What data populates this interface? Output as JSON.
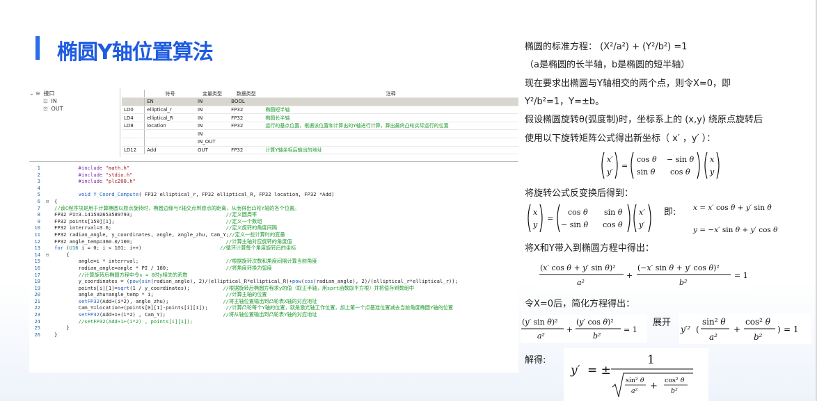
{
  "title": "椭圆Y轴位置算法",
  "tree": {
    "root": "接口",
    "items": [
      "IN",
      "OUT"
    ]
  },
  "var_table": {
    "headers": [
      "符号",
      "变量类型",
      "数据类型",
      "注释"
    ],
    "rows": [
      {
        "label": "",
        "name": "EN",
        "var_type": "IN",
        "data_type": "BOOL",
        "comment": ""
      },
      {
        "label": "LD0",
        "name": "elliptical_r",
        "var_type": "IN",
        "data_type": "FP32",
        "comment": "椭圆短半轴"
      },
      {
        "label": "LD4",
        "name": "elliptical_R",
        "var_type": "IN",
        "data_type": "FP32",
        "comment": "椭圆长半轴"
      },
      {
        "label": "LD8",
        "name": "location",
        "var_type": "IN",
        "data_type": "FP32",
        "comment": "运行的基点位置，根据该位置和计算出的Y轴进行计算，算出最终凸轮实际运行的位置"
      },
      {
        "label": "",
        "name": "",
        "var_type": "IN",
        "data_type": "",
        "comment": ""
      },
      {
        "label": "",
        "name": "",
        "var_type": "IN_OUT",
        "data_type": "",
        "comment": ""
      },
      {
        "label": "LD12",
        "name": "Add",
        "var_type": "OUT",
        "data_type": "FP32",
        "comment": "计算Y轴坐标后输出的地址"
      }
    ]
  },
  "code_lines": [
    {
      "n": "1",
      "fold": "",
      "html": "        <span class='mac'>#include</span> <span class='str'>\"math.h\"</span>"
    },
    {
      "n": "2",
      "fold": "",
      "html": "        <span class='mac'>#include</span> <span class='str'>\"stdio.h\"</span>"
    },
    {
      "n": "3",
      "fold": "",
      "html": "        <span class='mac'>#include</span> <span class='str'>\"plc200.h\"</span>"
    },
    {
      "n": "4",
      "fold": "",
      "html": ""
    },
    {
      "n": "5",
      "fold": "",
      "html": "        <span class='kw'>void</span> <span class='fn'>Y_Coord_Compute</span>( FP32 elliptical_r, FP32 elliptical_R, FP32 location, FP32 *Add)"
    },
    {
      "n": "6",
      "fold": "⊟",
      "html": "{"
    },
    {
      "n": "7",
      "fold": "",
      "html": "<span class='c'>//该C程序块是用于计算椭圆以原点旋转时，椭圆边缘与Y轴交点到原点的距离，从而得出凸轮Y轴的各个位置。</span>"
    },
    {
      "n": "8",
      "fold": "",
      "html": "FP32 PI=3.141592653589793;                               <span class='c'>//定义圆周率</span>"
    },
    {
      "n": "9",
      "fold": "",
      "html": "FP32 points[150][1];                                     <span class='c'>//定义一个数组</span>"
    },
    {
      "n": "10",
      "fold": "",
      "html": "FP32 interrval=3.6;                                      <span class='c'>//定义旋转的角度间隔</span>"
    },
    {
      "n": "11",
      "fold": "",
      "html": "FP32 radian_angle, y_coordinates, angle, angle_zhu, Cam_Y;<span class='c'>//定义一些计算时的变量</span>"
    },
    {
      "n": "12",
      "fold": "",
      "html": "FP32 angle_temp=360.0/100;                               <span class='c'>//计算主轴对应旋转的角度值</span>"
    },
    {
      "n": "13",
      "fold": "",
      "html": "<span class='kw'>for</span> (<span class='ty'>U16</span> i = 0; i &lt; 101; i++)                          <span class='c'>//循环计算每个角度旋转后的坐标</span>"
    },
    {
      "n": "14",
      "fold": "⊟",
      "html": "    {"
    },
    {
      "n": "15",
      "fold": "",
      "html": "        angle=i * interrval;                             <span class='c'>//根据旋转次数和角度间隔计算当前角度</span>"
    },
    {
      "n": "16",
      "fold": "",
      "html": "        radian_angle=angle * PI / 180;                   <span class='c'>//将角度转换为弧度</span>"
    },
    {
      "n": "17",
      "fold": "",
      "html": "        <span class='c'>//计算旋转后椭圆方程中令x = 0时y相关的系数</span>"
    },
    {
      "n": "18",
      "fold": "",
      "html": "        y_coordinates = (<span class='fn'>pow</span>(<span class='fn'>sin</span>(radian_angle), 2)/(elliptical_R*elliptical_R)+<span class='fn'>pow</span>(<span class='fn'>cos</span>(radian_angle), 2)/(elliptical_r*elliptical_r));"
    },
    {
      "n": "19",
      "fold": "",
      "html": "        points[i][1]=<span class='fn'>sqrt</span>(1 / y_coordinates);           <span class='c'>//根据旋转后椭圆方程求y的值（取正半轴，用sprt函数取平方根）并将值存到数组中</span>"
    },
    {
      "n": "20",
      "fold": "",
      "html": "        angle_zhu=angle_temp * i;                        <span class='c'>//计算主轴的位置</span>"
    },
    {
      "n": "21",
      "fold": "",
      "html": "        <span class='fn'>setFP32</span>(Add+(i*2), angle_zhu);                  <span class='c'>//将主轴位置输出到凸轮表X轴的对应地址</span>"
    },
    {
      "n": "22",
      "fold": "",
      "html": "        Cam_Y=location+(points[0][1]-points[i][1]);      <span class='c'>//计算凸轮每个Y轴的位置，就是激光轴工作位置，加上第一个点基准位置减去当前角度椭圆Y轴的位置</span>"
    },
    {
      "n": "23",
      "fold": "",
      "html": "        <span class='fn'>setFP32</span>(Add+1+(i*2) , Cam_Y);                   <span class='c'>//将从轴位置输出到凸轮表Y轴的对应地址</span>"
    },
    {
      "n": "24",
      "fold": "",
      "html": "        <span class='c'>//setFP32(Add+1+(i*2) , points[i][1]);</span>"
    },
    {
      "n": "25",
      "fold": "",
      "html": "    }"
    },
    {
      "n": "26",
      "fold": "",
      "html": "}"
    }
  ],
  "explanation": {
    "l1": "椭圆的标准方程：   (X²/a²)  +  (Y²/b²)   =1",
    "l2": "（a是椭圆的长半轴，b是椭圆的短半轴）",
    "l3": "现在要求出椭圆与Y轴相交的两个点，则令X=0，即",
    "l4": "Y²/b²=1，Y=±b。",
    "l5": "假设椭圆旋转θ(弧度制)时，坐标系上的  (x,y)  绕原点旋转后",
    "l6": "使用以下旋转矩阵公式得出新坐标（ x′ ，y′  ）：",
    "l7": "将旋转公式反变换后得到：",
    "jide": "即:",
    "l8": "将X和Y带入到椭圆方程中得出：",
    "l9": "令X=0后，简化方程得出：",
    "zhankai": "展开",
    "jiede": "解得:"
  }
}
